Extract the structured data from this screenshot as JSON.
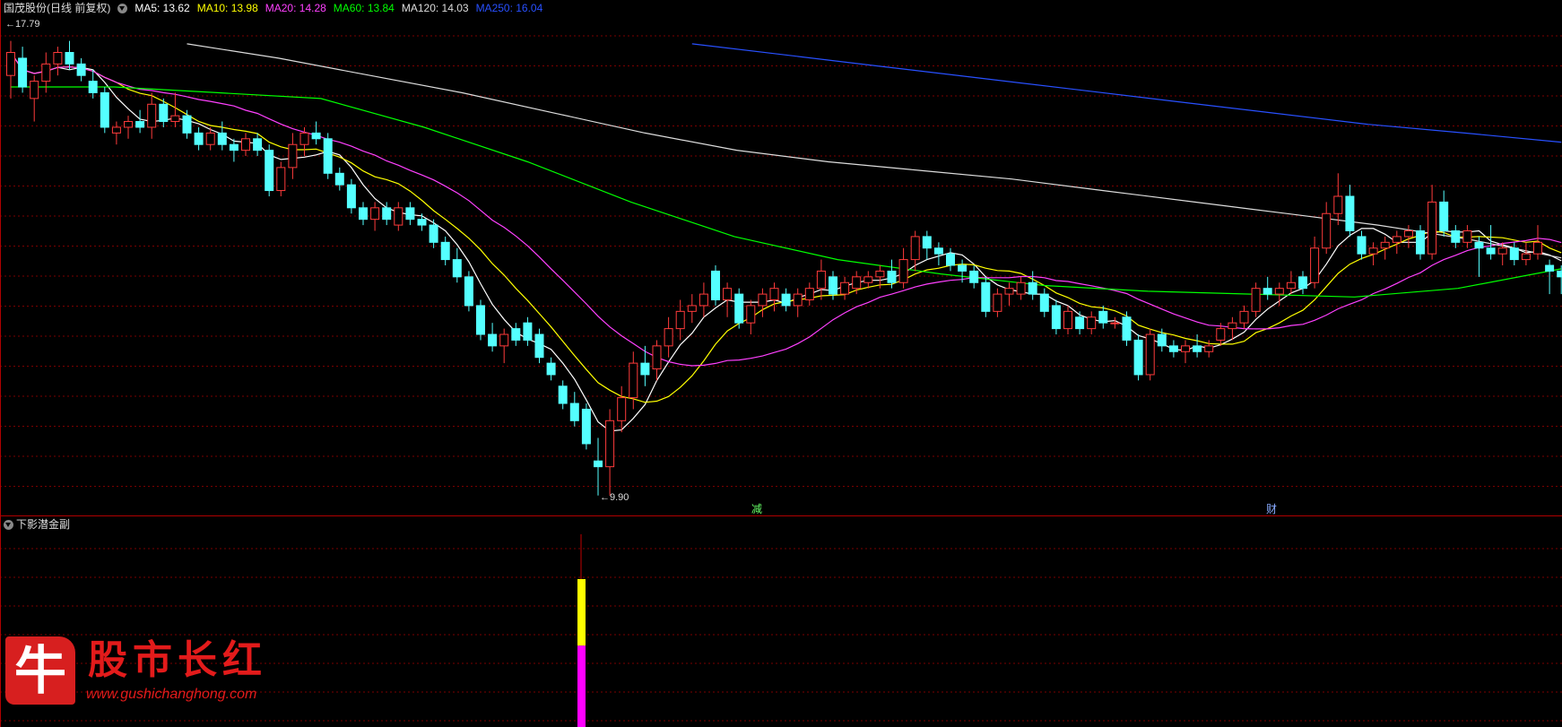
{
  "header": {
    "title": "国茂股份(日线 前复权)",
    "ma": [
      {
        "label": "MA5: 13.62",
        "color": "#ffffff"
      },
      {
        "label": "MA10: 13.98",
        "color": "#ffff00"
      },
      {
        "label": "MA20: 14.28",
        "color": "#ff40ff"
      },
      {
        "label": "MA60: 13.84",
        "color": "#00ff00"
      },
      {
        "label": "MA120: 14.03",
        "color": "#dddddd"
      },
      {
        "label": "MA250: 16.04",
        "color": "#2850ff"
      }
    ]
  },
  "annotations": {
    "high": "17.79",
    "low": "9.90",
    "marker1": "减",
    "marker2": "财"
  },
  "sub": {
    "title": "下影潜金副"
  },
  "logo": {
    "char": "牛",
    "title": "股市长红",
    "url": "www.gushichanghong.com"
  },
  "colors": {
    "up": "#ff3b3b",
    "down": "#54ffff",
    "grid": "#7a0000",
    "divider": "#b00000"
  },
  "chart_data": {
    "type": "candlestick",
    "ylim": [
      9.6,
      18.2
    ],
    "candles": [
      {
        "o": 17.2,
        "h": 17.8,
        "l": 16.8,
        "c": 17.6
      },
      {
        "o": 17.5,
        "h": 17.7,
        "l": 16.9,
        "c": 17.0
      },
      {
        "o": 16.8,
        "h": 17.2,
        "l": 16.4,
        "c": 17.1
      },
      {
        "o": 17.1,
        "h": 17.6,
        "l": 16.9,
        "c": 17.4
      },
      {
        "o": 17.4,
        "h": 17.7,
        "l": 17.2,
        "c": 17.6
      },
      {
        "o": 17.6,
        "h": 17.8,
        "l": 17.3,
        "c": 17.4
      },
      {
        "o": 17.4,
        "h": 17.5,
        "l": 17.1,
        "c": 17.2
      },
      {
        "o": 17.1,
        "h": 17.3,
        "l": 16.8,
        "c": 16.9
      },
      {
        "o": 16.9,
        "h": 17.0,
        "l": 16.2,
        "c": 16.3
      },
      {
        "o": 16.2,
        "h": 16.4,
        "l": 16.0,
        "c": 16.3
      },
      {
        "o": 16.3,
        "h": 16.5,
        "l": 16.1,
        "c": 16.4
      },
      {
        "o": 16.4,
        "h": 16.6,
        "l": 16.2,
        "c": 16.3
      },
      {
        "o": 16.3,
        "h": 16.9,
        "l": 16.1,
        "c": 16.7
      },
      {
        "o": 16.7,
        "h": 16.8,
        "l": 16.3,
        "c": 16.4
      },
      {
        "o": 16.4,
        "h": 16.9,
        "l": 16.3,
        "c": 16.5
      },
      {
        "o": 16.5,
        "h": 16.6,
        "l": 16.1,
        "c": 16.2
      },
      {
        "o": 16.2,
        "h": 16.3,
        "l": 15.9,
        "c": 16.0
      },
      {
        "o": 16.0,
        "h": 16.3,
        "l": 15.9,
        "c": 16.2
      },
      {
        "o": 16.2,
        "h": 16.4,
        "l": 15.9,
        "c": 16.0
      },
      {
        "o": 16.0,
        "h": 16.1,
        "l": 15.7,
        "c": 15.9
      },
      {
        "o": 15.9,
        "h": 16.2,
        "l": 15.8,
        "c": 16.1
      },
      {
        "o": 16.1,
        "h": 16.2,
        "l": 15.8,
        "c": 15.9
      },
      {
        "o": 15.9,
        "h": 16.0,
        "l": 15.1,
        "c": 15.2
      },
      {
        "o": 15.2,
        "h": 15.7,
        "l": 15.1,
        "c": 15.6
      },
      {
        "o": 15.6,
        "h": 16.2,
        "l": 15.4,
        "c": 16.0
      },
      {
        "o": 16.0,
        "h": 16.3,
        "l": 15.8,
        "c": 16.2
      },
      {
        "o": 16.2,
        "h": 16.4,
        "l": 16.0,
        "c": 16.1
      },
      {
        "o": 16.1,
        "h": 16.2,
        "l": 15.4,
        "c": 15.5
      },
      {
        "o": 15.5,
        "h": 15.6,
        "l": 15.2,
        "c": 15.3
      },
      {
        "o": 15.3,
        "h": 15.4,
        "l": 14.8,
        "c": 14.9
      },
      {
        "o": 14.9,
        "h": 15.0,
        "l": 14.6,
        "c": 14.7
      },
      {
        "o": 14.7,
        "h": 15.0,
        "l": 14.5,
        "c": 14.9
      },
      {
        "o": 14.9,
        "h": 15.0,
        "l": 14.6,
        "c": 14.7
      },
      {
        "o": 14.6,
        "h": 15.0,
        "l": 14.5,
        "c": 14.9
      },
      {
        "o": 14.9,
        "h": 15.0,
        "l": 14.6,
        "c": 14.7
      },
      {
        "o": 14.7,
        "h": 14.8,
        "l": 14.5,
        "c": 14.6
      },
      {
        "o": 14.6,
        "h": 14.7,
        "l": 14.2,
        "c": 14.3
      },
      {
        "o": 14.3,
        "h": 14.4,
        "l": 13.9,
        "c": 14.0
      },
      {
        "o": 14.0,
        "h": 14.2,
        "l": 13.6,
        "c": 13.7
      },
      {
        "o": 13.7,
        "h": 13.8,
        "l": 13.1,
        "c": 13.2
      },
      {
        "o": 13.2,
        "h": 13.3,
        "l": 12.6,
        "c": 12.7
      },
      {
        "o": 12.7,
        "h": 12.9,
        "l": 12.4,
        "c": 12.5
      },
      {
        "o": 12.5,
        "h": 12.8,
        "l": 12.2,
        "c": 12.7
      },
      {
        "o": 12.8,
        "h": 12.9,
        "l": 12.5,
        "c": 12.6
      },
      {
        "o": 12.9,
        "h": 13.0,
        "l": 12.5,
        "c": 12.6
      },
      {
        "o": 12.7,
        "h": 12.8,
        "l": 12.2,
        "c": 12.3
      },
      {
        "o": 12.2,
        "h": 12.3,
        "l": 11.9,
        "c": 12.0
      },
      {
        "o": 11.8,
        "h": 11.9,
        "l": 11.4,
        "c": 11.5
      },
      {
        "o": 11.5,
        "h": 11.7,
        "l": 11.1,
        "c": 11.2
      },
      {
        "o": 11.4,
        "h": 11.5,
        "l": 10.7,
        "c": 10.8
      },
      {
        "o": 10.5,
        "h": 10.9,
        "l": 9.9,
        "c": 10.4
      },
      {
        "o": 10.4,
        "h": 11.4,
        "l": 9.9,
        "c": 11.2
      },
      {
        "o": 11.2,
        "h": 11.8,
        "l": 11.0,
        "c": 11.6
      },
      {
        "o": 11.6,
        "h": 12.4,
        "l": 11.4,
        "c": 12.2
      },
      {
        "o": 12.2,
        "h": 12.5,
        "l": 11.8,
        "c": 12.0
      },
      {
        "o": 12.1,
        "h": 12.6,
        "l": 11.9,
        "c": 12.5
      },
      {
        "o": 12.5,
        "h": 13.0,
        "l": 12.3,
        "c": 12.8
      },
      {
        "o": 12.8,
        "h": 13.3,
        "l": 12.6,
        "c": 13.1
      },
      {
        "o": 13.1,
        "h": 13.4,
        "l": 12.9,
        "c": 13.2
      },
      {
        "o": 13.2,
        "h": 13.6,
        "l": 13.0,
        "c": 13.4
      },
      {
        "o": 13.8,
        "h": 13.9,
        "l": 13.2,
        "c": 13.3
      },
      {
        "o": 13.3,
        "h": 13.6,
        "l": 13.0,
        "c": 13.5
      },
      {
        "o": 13.4,
        "h": 13.5,
        "l": 12.8,
        "c": 12.9
      },
      {
        "o": 12.9,
        "h": 13.3,
        "l": 12.7,
        "c": 13.2
      },
      {
        "o": 13.2,
        "h": 13.5,
        "l": 13.0,
        "c": 13.4
      },
      {
        "o": 13.3,
        "h": 13.6,
        "l": 13.1,
        "c": 13.5
      },
      {
        "o": 13.4,
        "h": 13.5,
        "l": 13.1,
        "c": 13.2
      },
      {
        "o": 13.2,
        "h": 13.5,
        "l": 13.0,
        "c": 13.4
      },
      {
        "o": 13.3,
        "h": 13.6,
        "l": 13.2,
        "c": 13.5
      },
      {
        "o": 13.5,
        "h": 14.0,
        "l": 13.3,
        "c": 13.8
      },
      {
        "o": 13.7,
        "h": 13.8,
        "l": 13.3,
        "c": 13.4
      },
      {
        "o": 13.4,
        "h": 13.7,
        "l": 13.3,
        "c": 13.6
      },
      {
        "o": 13.5,
        "h": 13.8,
        "l": 13.4,
        "c": 13.7
      },
      {
        "o": 13.6,
        "h": 13.8,
        "l": 13.5,
        "c": 13.7
      },
      {
        "o": 13.7,
        "h": 13.9,
        "l": 13.5,
        "c": 13.8
      },
      {
        "o": 13.8,
        "h": 14.0,
        "l": 13.5,
        "c": 13.6
      },
      {
        "o": 13.6,
        "h": 14.2,
        "l": 13.5,
        "c": 14.0
      },
      {
        "o": 14.0,
        "h": 14.5,
        "l": 13.8,
        "c": 14.4
      },
      {
        "o": 14.4,
        "h": 14.5,
        "l": 14.0,
        "c": 14.2
      },
      {
        "o": 14.2,
        "h": 14.3,
        "l": 13.9,
        "c": 14.1
      },
      {
        "o": 14.1,
        "h": 14.2,
        "l": 13.8,
        "c": 13.9
      },
      {
        "o": 13.9,
        "h": 14.0,
        "l": 13.6,
        "c": 13.8
      },
      {
        "o": 13.8,
        "h": 13.9,
        "l": 13.5,
        "c": 13.6
      },
      {
        "o": 13.6,
        "h": 13.7,
        "l": 13.0,
        "c": 13.1
      },
      {
        "o": 13.1,
        "h": 13.5,
        "l": 13.0,
        "c": 13.4
      },
      {
        "o": 13.4,
        "h": 13.6,
        "l": 13.2,
        "c": 13.5
      },
      {
        "o": 13.4,
        "h": 13.7,
        "l": 13.3,
        "c": 13.6
      },
      {
        "o": 13.6,
        "h": 13.8,
        "l": 13.3,
        "c": 13.4
      },
      {
        "o": 13.4,
        "h": 13.5,
        "l": 13.0,
        "c": 13.1
      },
      {
        "o": 13.2,
        "h": 13.3,
        "l": 12.7,
        "c": 12.8
      },
      {
        "o": 12.8,
        "h": 13.2,
        "l": 12.7,
        "c": 13.1
      },
      {
        "o": 13.0,
        "h": 13.1,
        "l": 12.7,
        "c": 12.8
      },
      {
        "o": 12.8,
        "h": 13.1,
        "l": 12.7,
        "c": 13.0
      },
      {
        "o": 13.1,
        "h": 13.2,
        "l": 12.8,
        "c": 12.9
      },
      {
        "o": 12.9,
        "h": 13.0,
        "l": 12.8,
        "c": 12.9
      },
      {
        "o": 13.0,
        "h": 13.1,
        "l": 12.5,
        "c": 12.6
      },
      {
        "o": 12.6,
        "h": 12.7,
        "l": 11.9,
        "c": 12.0
      },
      {
        "o": 12.0,
        "h": 12.8,
        "l": 11.9,
        "c": 12.7
      },
      {
        "o": 12.7,
        "h": 12.8,
        "l": 12.4,
        "c": 12.5
      },
      {
        "o": 12.5,
        "h": 12.6,
        "l": 12.3,
        "c": 12.4
      },
      {
        "o": 12.4,
        "h": 12.6,
        "l": 12.2,
        "c": 12.5
      },
      {
        "o": 12.5,
        "h": 12.7,
        "l": 12.3,
        "c": 12.4
      },
      {
        "o": 12.4,
        "h": 12.6,
        "l": 12.3,
        "c": 12.5
      },
      {
        "o": 12.6,
        "h": 12.9,
        "l": 12.5,
        "c": 12.8
      },
      {
        "o": 12.8,
        "h": 13.0,
        "l": 12.6,
        "c": 12.9
      },
      {
        "o": 12.9,
        "h": 13.2,
        "l": 12.8,
        "c": 13.1
      },
      {
        "o": 13.1,
        "h": 13.6,
        "l": 13.0,
        "c": 13.5
      },
      {
        "o": 13.5,
        "h": 13.7,
        "l": 13.3,
        "c": 13.4
      },
      {
        "o": 13.4,
        "h": 13.6,
        "l": 13.2,
        "c": 13.5
      },
      {
        "o": 13.5,
        "h": 13.8,
        "l": 13.4,
        "c": 13.6
      },
      {
        "o": 13.7,
        "h": 13.8,
        "l": 13.4,
        "c": 13.5
      },
      {
        "o": 13.6,
        "h": 14.4,
        "l": 13.5,
        "c": 14.2
      },
      {
        "o": 14.2,
        "h": 15.0,
        "l": 14.1,
        "c": 14.8
      },
      {
        "o": 14.8,
        "h": 15.5,
        "l": 14.6,
        "c": 15.1
      },
      {
        "o": 15.1,
        "h": 15.3,
        "l": 14.4,
        "c": 14.5
      },
      {
        "o": 14.4,
        "h": 14.5,
        "l": 14.0,
        "c": 14.1
      },
      {
        "o": 14.1,
        "h": 14.3,
        "l": 13.9,
        "c": 14.2
      },
      {
        "o": 14.2,
        "h": 14.4,
        "l": 14.0,
        "c": 14.3
      },
      {
        "o": 14.3,
        "h": 14.5,
        "l": 14.1,
        "c": 14.4
      },
      {
        "o": 14.4,
        "h": 14.6,
        "l": 14.2,
        "c": 14.5
      },
      {
        "o": 14.5,
        "h": 14.6,
        "l": 14.0,
        "c": 14.1
      },
      {
        "o": 14.1,
        "h": 15.3,
        "l": 14.0,
        "c": 15.0
      },
      {
        "o": 15.0,
        "h": 15.2,
        "l": 14.4,
        "c": 14.5
      },
      {
        "o": 14.5,
        "h": 14.6,
        "l": 14.2,
        "c": 14.3
      },
      {
        "o": 14.3,
        "h": 14.6,
        "l": 14.2,
        "c": 14.5
      },
      {
        "o": 14.3,
        "h": 14.4,
        "l": 13.7,
        "c": 14.2
      },
      {
        "o": 14.2,
        "h": 14.6,
        "l": 14.0,
        "c": 14.1
      },
      {
        "o": 14.1,
        "h": 14.3,
        "l": 13.9,
        "c": 14.2
      },
      {
        "o": 14.2,
        "h": 14.3,
        "l": 13.9,
        "c": 14.0
      },
      {
        "o": 14.0,
        "h": 14.3,
        "l": 13.9,
        "c": 14.1
      },
      {
        "o": 14.1,
        "h": 14.6,
        "l": 14.0,
        "c": 14.3
      },
      {
        "o": 13.9,
        "h": 14.0,
        "l": 13.4,
        "c": 13.8
      },
      {
        "o": 13.8,
        "h": 13.9,
        "l": 13.4,
        "c": 13.7
      }
    ],
    "sub_bar": {
      "index": 50,
      "segments": [
        {
          "name": "yellow",
          "from": 0,
          "to": 0.45,
          "color": "#ffff00"
        },
        {
          "name": "magenta",
          "from": 0.45,
          "to": 1,
          "color": "#ff00ff"
        }
      ]
    }
  }
}
